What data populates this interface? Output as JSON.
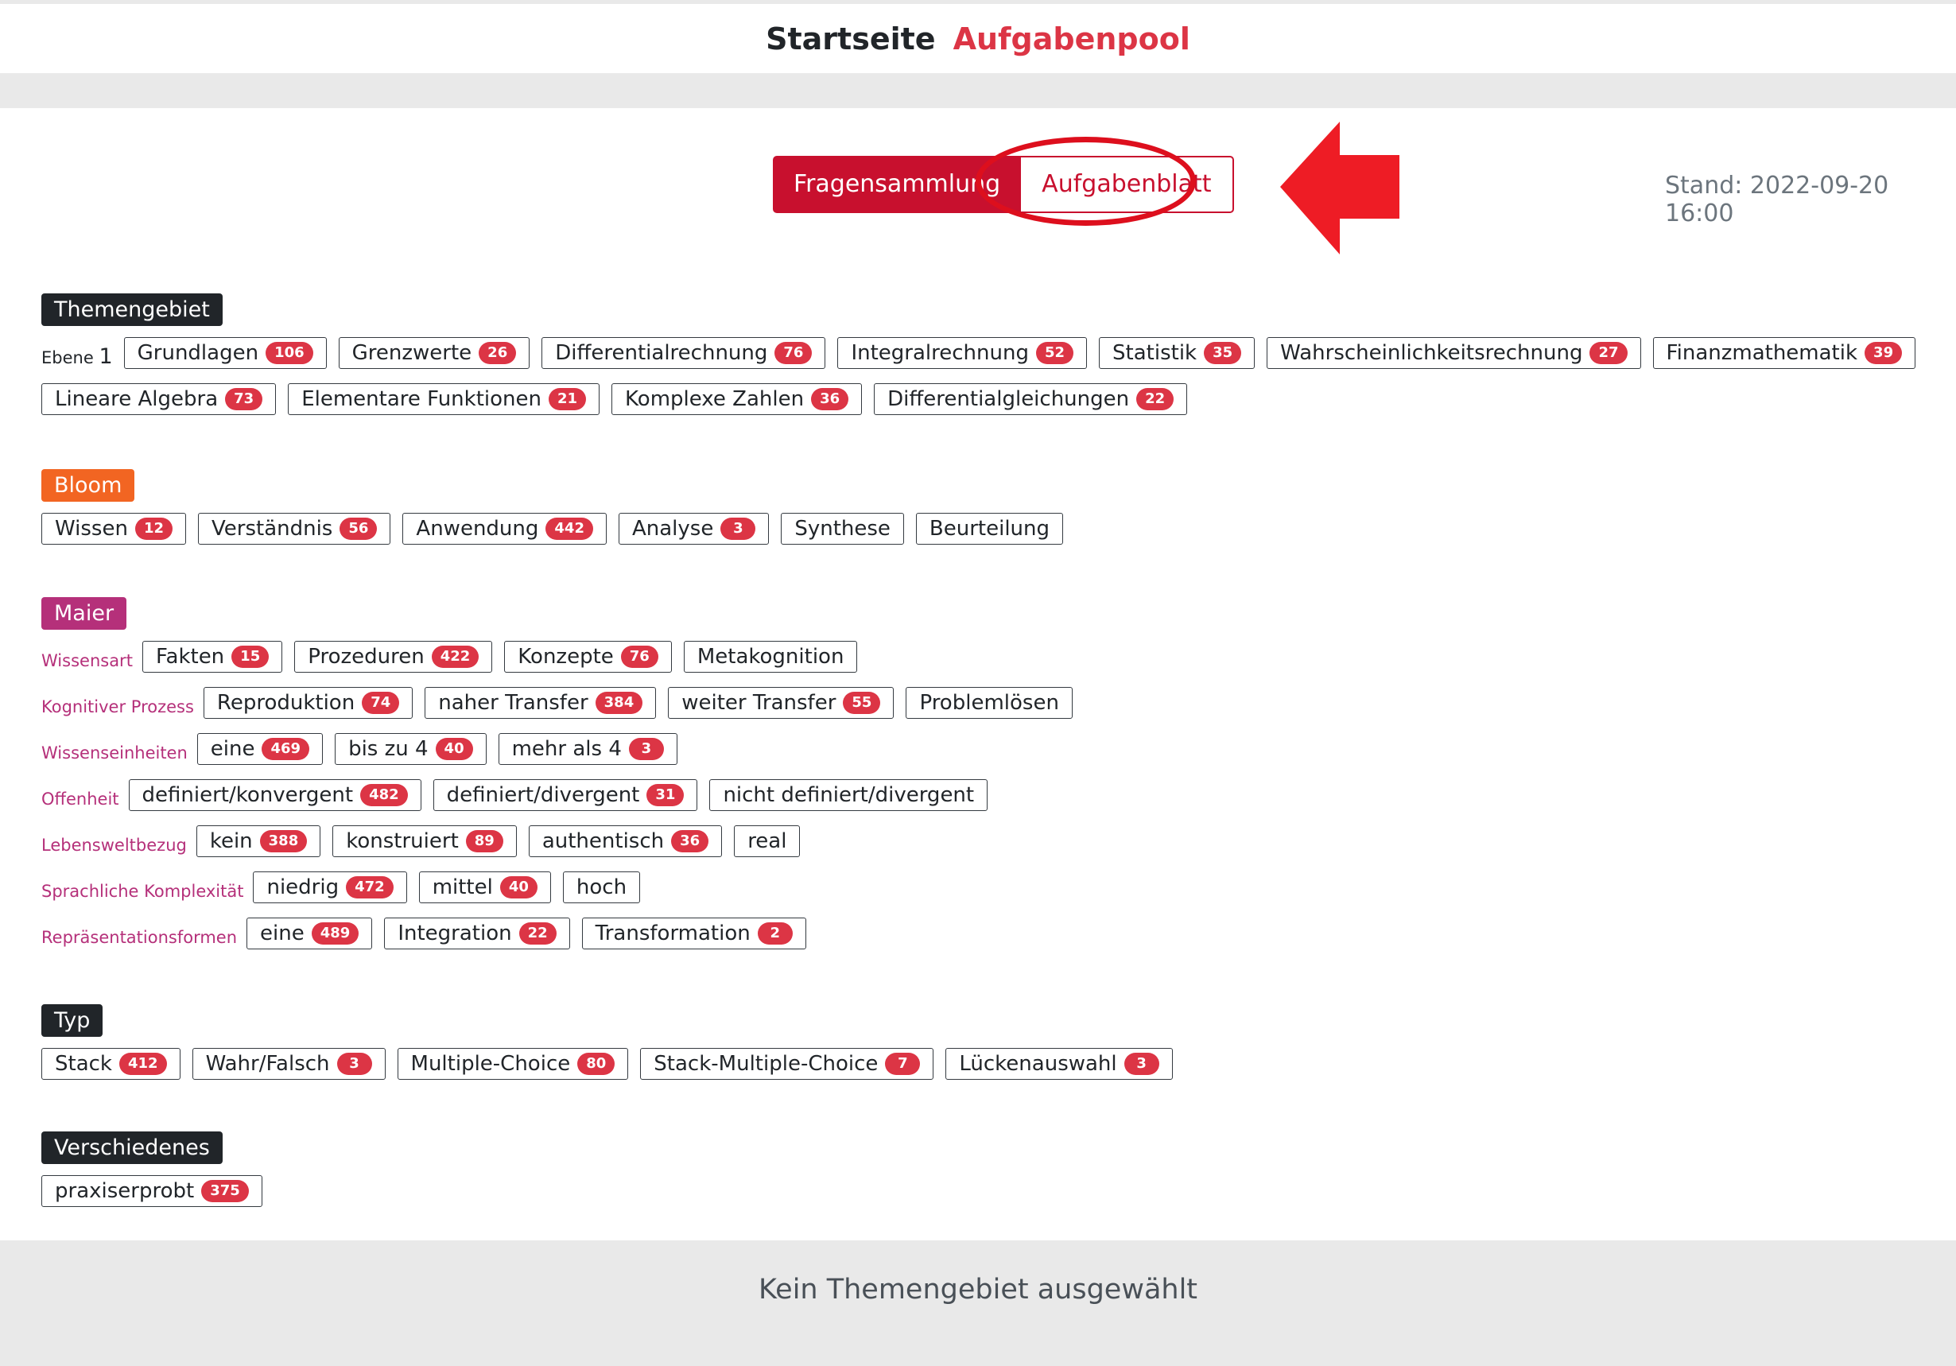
{
  "nav": {
    "home": "Startseite",
    "pool": "Aufgabenpool"
  },
  "toggle": {
    "left": "Fragensammlung",
    "right": "Aufgabenblatt"
  },
  "stand": "Stand: 2022-09-20 16:00",
  "themengebiet": {
    "title": "Themengebiet",
    "ebene_label": "Ebene",
    "ebene_num": "1",
    "chips": [
      {
        "label": "Grundlagen",
        "count": "106"
      },
      {
        "label": "Grenzwerte",
        "count": "26"
      },
      {
        "label": "Differentialrechnung",
        "count": "76"
      },
      {
        "label": "Integralrechnung",
        "count": "52"
      },
      {
        "label": "Statistik",
        "count": "35"
      },
      {
        "label": "Wahrscheinlichkeitsrechnung",
        "count": "27"
      },
      {
        "label": "Finanzmathematik",
        "count": "39"
      },
      {
        "label": "Lineare Algebra",
        "count": "73"
      },
      {
        "label": "Elementare Funktionen",
        "count": "21"
      },
      {
        "label": "Komplexe Zahlen",
        "count": "36"
      },
      {
        "label": "Differentialgleichungen",
        "count": "22"
      }
    ]
  },
  "bloom": {
    "title": "Bloom",
    "chips": [
      {
        "label": "Wissen",
        "count": "12"
      },
      {
        "label": "Verständnis",
        "count": "56"
      },
      {
        "label": "Anwendung",
        "count": "442"
      },
      {
        "label": "Analyse",
        "count": "3"
      },
      {
        "label": "Synthese",
        "count": ""
      },
      {
        "label": "Beurteilung",
        "count": ""
      }
    ]
  },
  "maier": {
    "title": "Maier",
    "rows": [
      {
        "label": "Wissensart",
        "chips": [
          {
            "label": "Fakten",
            "count": "15"
          },
          {
            "label": "Prozeduren",
            "count": "422"
          },
          {
            "label": "Konzepte",
            "count": "76"
          },
          {
            "label": "Metakognition",
            "count": ""
          }
        ]
      },
      {
        "label": "Kognitiver Prozess",
        "chips": [
          {
            "label": "Reproduktion",
            "count": "74"
          },
          {
            "label": "naher Transfer",
            "count": "384"
          },
          {
            "label": "weiter Transfer",
            "count": "55"
          },
          {
            "label": "Problemlösen",
            "count": ""
          }
        ]
      },
      {
        "label": "Wissenseinheiten",
        "chips": [
          {
            "label": "eine",
            "count": "469"
          },
          {
            "label": "bis zu 4",
            "count": "40"
          },
          {
            "label": "mehr als 4",
            "count": "3"
          }
        ]
      },
      {
        "label": "Offenheit",
        "chips": [
          {
            "label": "definiert/konvergent",
            "count": "482"
          },
          {
            "label": "definiert/divergent",
            "count": "31"
          },
          {
            "label": "nicht definiert/divergent",
            "count": ""
          }
        ]
      },
      {
        "label": "Lebensweltbezug",
        "chips": [
          {
            "label": "kein",
            "count": "388"
          },
          {
            "label": "konstruiert",
            "count": "89"
          },
          {
            "label": "authentisch",
            "count": "36"
          },
          {
            "label": "real",
            "count": ""
          }
        ]
      },
      {
        "label": "Sprachliche Komplexität",
        "chips": [
          {
            "label": "niedrig",
            "count": "472"
          },
          {
            "label": "mittel",
            "count": "40"
          },
          {
            "label": "hoch",
            "count": ""
          }
        ]
      },
      {
        "label": "Repräsentationsformen",
        "chips": [
          {
            "label": "eine",
            "count": "489"
          },
          {
            "label": "Integration",
            "count": "22"
          },
          {
            "label": "Transformation",
            "count": "2"
          }
        ]
      }
    ]
  },
  "typ": {
    "title": "Typ",
    "chips": [
      {
        "label": "Stack",
        "count": "412"
      },
      {
        "label": "Wahr/Falsch",
        "count": "3"
      },
      {
        "label": "Multiple-Choice",
        "count": "80"
      },
      {
        "label": "Stack-Multiple-Choice",
        "count": "7"
      },
      {
        "label": "Lückenauswahl",
        "count": "3"
      }
    ]
  },
  "verschiedenes": {
    "title": "Verschiedenes",
    "chips": [
      {
        "label": "praxiserprobt",
        "count": "375"
      }
    ]
  },
  "footer": "Kein Themengebiet ausgewählt",
  "colors": {
    "accent": "#c8102e",
    "badge": "#dc3545",
    "dark": "#212529",
    "bloom": "#f26522",
    "maier": "#b5307a",
    "annotation": "#dd0f1d"
  }
}
